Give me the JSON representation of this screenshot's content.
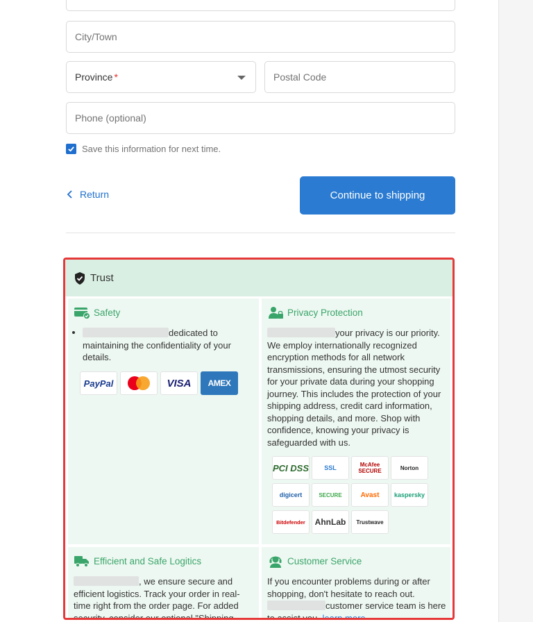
{
  "form": {
    "city_placeholder": "City/Town",
    "province_label": "Province",
    "province_required_mark": "*",
    "postal_placeholder": "Postal Code",
    "phone_placeholder": "Phone (optional)",
    "save_info_label": "Save this information for next time.",
    "save_info_checked": true,
    "return_label": "Return",
    "continue_label": "Continue to shipping"
  },
  "trust": {
    "title": "Trust",
    "safety": {
      "title": "Safety",
      "text": "dedicated to maintaining the confidentiality of your details.",
      "cards": [
        "PayPal",
        "VISA",
        "AMEX"
      ]
    },
    "privacy": {
      "title": "Privacy Protection",
      "text": "your privacy is our priority. We employ internationally recognized encryption methods for all network transmissions, ensuring the utmost security for your private data during your shopping journey. This includes the protection of your shipping address, credit card information, shopping details, and more. Shop with confidence, knowing your privacy is safeguarded with us.",
      "badges": [
        "PCI DSS",
        "SSL",
        "McAfee SECURE",
        "Norton",
        "digicert",
        "SECURE",
        "Avast",
        "kaspersky",
        "Bitdefender",
        "AhnLab",
        "Trustwave"
      ]
    },
    "logistics": {
      "title": "Efficient and Safe Logitics",
      "text": ", we ensure secure and efficient logistics. Track your order in real-time right from the order page. For added security, consider our optional \"Shipping"
    },
    "service": {
      "title": "Customer Service",
      "text1": "If you encounter problems during or after shopping, don't hesitate to reach out.",
      "text2": "customer service team is here to assist you.",
      "learn_more": "learn more"
    }
  },
  "colors": {
    "accent": "#2a7bd1",
    "trust_green": "#3aa56a",
    "highlight_border": "#e53939"
  }
}
